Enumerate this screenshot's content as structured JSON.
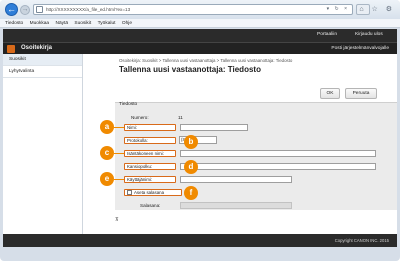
{
  "browser": {
    "address": "http://XXXXXXXXX/a_file_ed.html?ex=13",
    "menu": [
      "Tiedosto",
      "Muokkaa",
      "Näytä",
      "Suosikit",
      "Työkalut",
      "Ohje"
    ]
  },
  "topbar": {
    "portal": "Portaaliin",
    "logout": "Kirjaudu ulos"
  },
  "header": {
    "title": "Osoitekirja",
    "mail_admin": "Posti järjestelmänvalvojalle"
  },
  "sidebar": {
    "items": [
      {
        "label": "Suosikit"
      },
      {
        "label": "Lyhytvalinta"
      }
    ]
  },
  "breadcrumb": "Osoitekirja: Suosikit > Tallenna uusi vastaanottaja > Tallenna uusi vastaanottaja: Tiedosto",
  "form": {
    "title": "Tallenna uusi vastaanottaja: Tiedosto",
    "ok_label": "OK",
    "cancel_label": "Peruuta",
    "section_title": "Tiedosto",
    "number_label": "Numero:",
    "number_value": "11",
    "name_label": "Nimi:",
    "protocol_label": "Protokolla:",
    "protocol_value": "(SMB)",
    "host_label": "Isäntäkoneen nimi:",
    "path_label": "Kansiopolku:",
    "user_label": "Käyttäjänimi:",
    "password_set_label": "Aseta salasana",
    "password_label": "Salasana:"
  },
  "callouts": [
    "a",
    "b",
    "c",
    "d",
    "e",
    "f"
  ],
  "footer": "Copyright CANON INC. 2015",
  "colors": {
    "accent": "#f08a00",
    "header": "#222222"
  }
}
